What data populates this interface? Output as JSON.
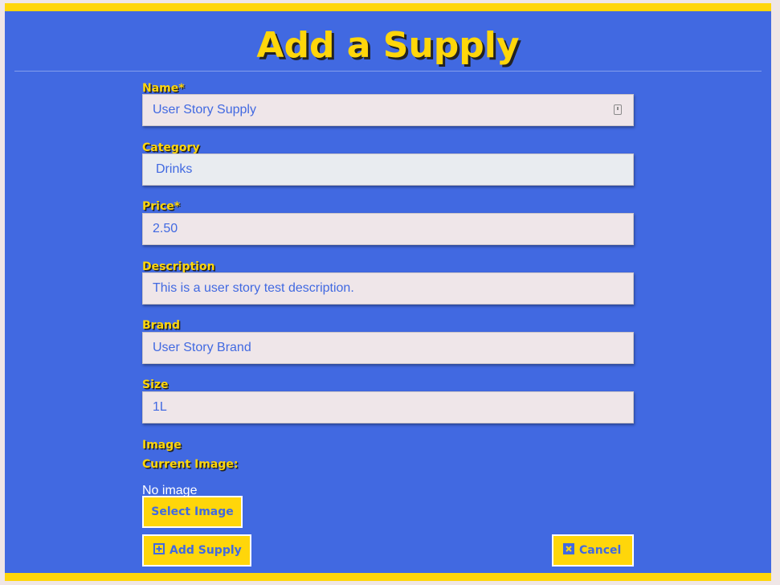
{
  "page": {
    "title": "Add a Supply"
  },
  "form": {
    "name_label": "Name*",
    "name_value": "User Story Supply",
    "category_label": "Category",
    "category_value": "Drinks",
    "price_label": "Price*",
    "price_value": "2.50",
    "description_label": "Description",
    "description_value": "This is a user story test description.",
    "brand_label": "Brand",
    "brand_value": "User Story Brand",
    "size_label": "Size",
    "size_value": "1L",
    "image_label": "Image",
    "current_image_label": "Current Image:",
    "no_image_text": "No image"
  },
  "actions": {
    "select_image_label": "Select Image",
    "add_supply_label": "Add Supply",
    "add_supply_icon": "plus-square-icon",
    "cancel_label": "Cancel",
    "cancel_icon": "close-square-icon"
  },
  "colors": {
    "background": "#4169e1",
    "accent": "#ffd60a",
    "field_background": "#efe6e9",
    "page_outer": "#efe6e6"
  }
}
